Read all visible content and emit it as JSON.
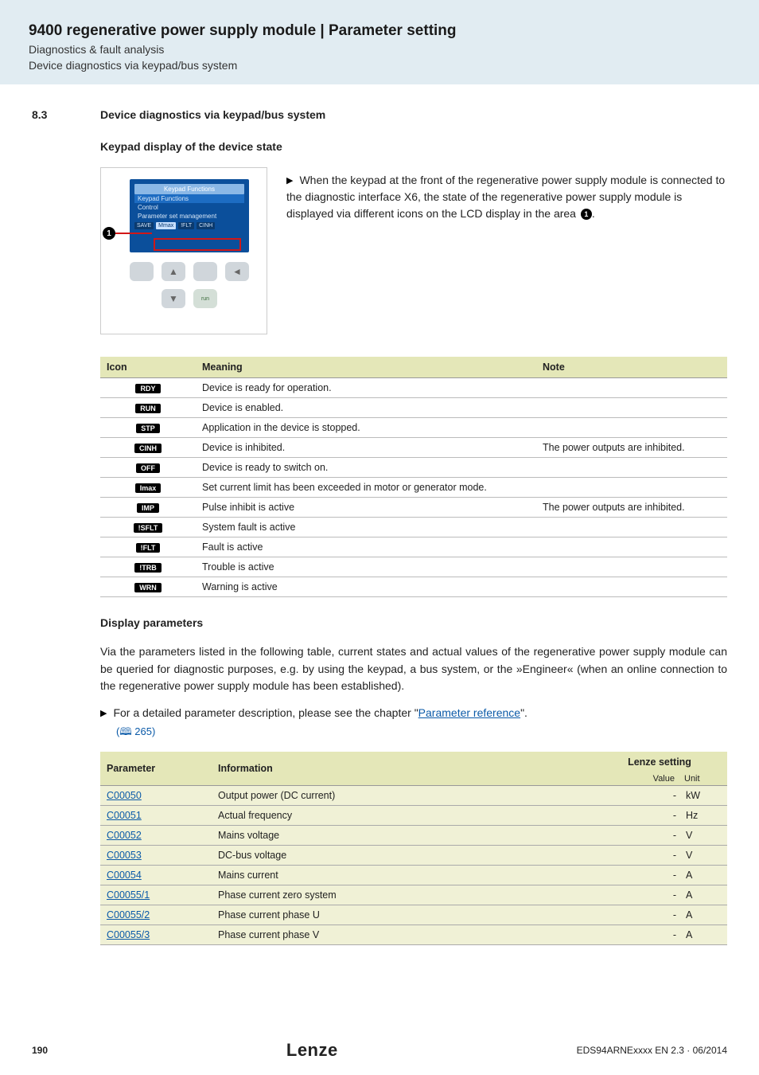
{
  "header": {
    "title": "9400 regenerative power supply module | Parameter setting",
    "sub1": "Diagnostics & fault analysis",
    "sub2": "Device diagnostics via keypad/bus system"
  },
  "section": {
    "num": "8.3",
    "title": "Device diagnostics via keypad/bus system"
  },
  "keypad": {
    "subhead": "Keypad display of the device state",
    "screen_title": "Keypad Functions",
    "screen_line1": "Keypad Functions",
    "screen_line2": "Control",
    "screen_line3": "Parameter set management",
    "status": [
      "SAVE",
      "Mmax",
      "!FLT",
      "CINH"
    ],
    "callout": "1",
    "run_label": "run",
    "desc_prefix": "When the keypad at the front of the regenerative power supply module is connected to the diagnostic interface X6, the state of the regenerative power supply module is displayed via different icons on the LCD display in the area ",
    "desc_callout": "1",
    "desc_suffix": "."
  },
  "icon_table": {
    "headers": {
      "icon": "Icon",
      "meaning": "Meaning",
      "note": "Note"
    },
    "rows": [
      {
        "icon": "RDY",
        "meaning": "Device is ready for operation.",
        "note": ""
      },
      {
        "icon": "RUN",
        "meaning": "Device is enabled.",
        "note": ""
      },
      {
        "icon": "STP",
        "meaning": "Application in the device is stopped.",
        "note": ""
      },
      {
        "icon": "CINH",
        "meaning": "Device is inhibited.",
        "note": "The power outputs are inhibited."
      },
      {
        "icon": "OFF",
        "meaning": "Device is ready to switch on.",
        "note": ""
      },
      {
        "icon": "Imax",
        "meaning": "Set current limit has been exceeded in motor or generator mode.",
        "note": ""
      },
      {
        "icon": "IMP",
        "meaning": "Pulse inhibit is active",
        "note": "The power outputs are inhibited."
      },
      {
        "icon": "!SFLT",
        "meaning": "System fault is active",
        "note": ""
      },
      {
        "icon": "!FLT",
        "meaning": "Fault is active",
        "note": ""
      },
      {
        "icon": "!TRB",
        "meaning": "Trouble is active",
        "note": ""
      },
      {
        "icon": "WRN",
        "meaning": "Warning is active",
        "note": ""
      }
    ]
  },
  "display_params": {
    "subhead": "Display parameters",
    "para": "Via the parameters listed in the following table, current states and actual values of the regenerative power supply module can be queried for diagnostic purposes, e.g. by using the keypad, a bus system, or the »Engineer« (when an online connection to the regenerative power supply module has been established).",
    "bullet_prefix": "For a detailed parameter description, please see the chapter \"",
    "bullet_link": "Parameter reference",
    "bullet_suffix": "\".",
    "page_ref": "(🕮 265)"
  },
  "param_table": {
    "headers": {
      "param": "Parameter",
      "info": "Information",
      "lenze": "Lenze setting",
      "value": "Value",
      "unit": "Unit"
    },
    "rows": [
      {
        "param": "C00050",
        "info": "Output power (DC current)",
        "value": "-",
        "unit": "kW"
      },
      {
        "param": "C00051",
        "info": "Actual frequency",
        "value": "-",
        "unit": "Hz"
      },
      {
        "param": "C00052",
        "info": "Mains voltage",
        "value": "-",
        "unit": "V"
      },
      {
        "param": "C00053",
        "info": "DC-bus voltage",
        "value": "-",
        "unit": "V"
      },
      {
        "param": "C00054",
        "info": "Mains current",
        "value": "-",
        "unit": "A"
      },
      {
        "param": "C00055/1",
        "info": "Phase current zero system",
        "value": "-",
        "unit": "A"
      },
      {
        "param": "C00055/2",
        "info": "Phase current phase U",
        "value": "-",
        "unit": "A"
      },
      {
        "param": "C00055/3",
        "info": "Phase current phase V",
        "value": "-",
        "unit": "A"
      }
    ]
  },
  "footer": {
    "page": "190",
    "brand": "Lenze",
    "docid": "EDS94ARNExxxx EN 2.3 · 06/2014"
  }
}
